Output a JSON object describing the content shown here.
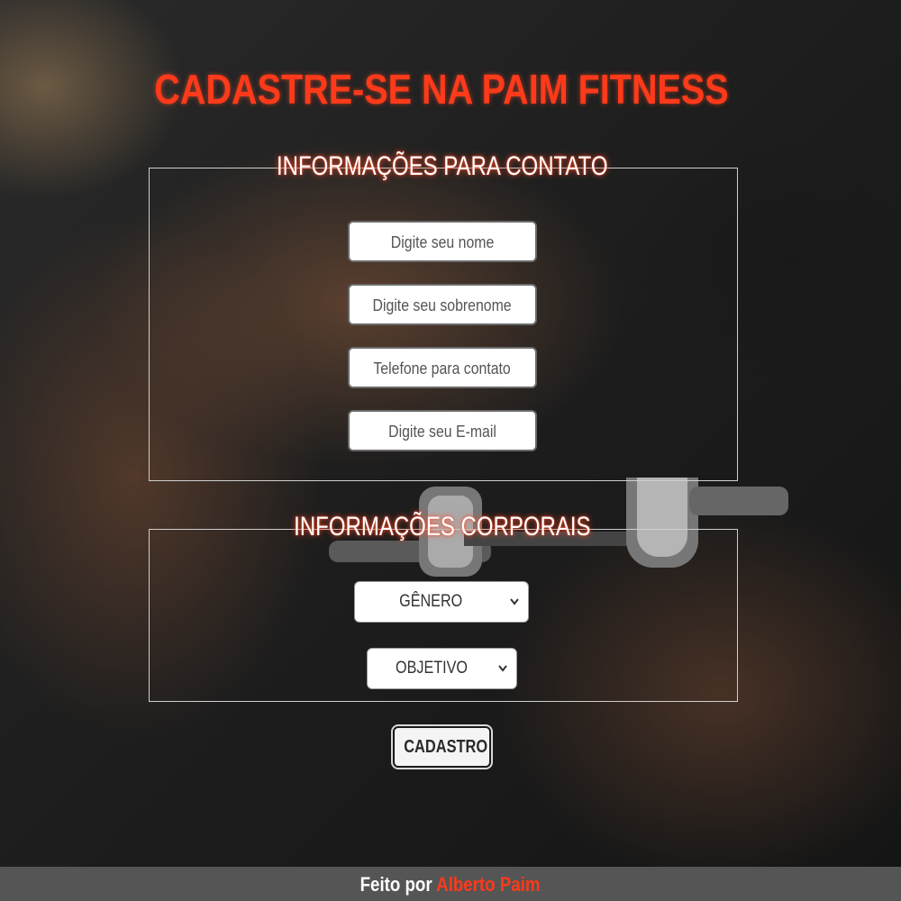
{
  "header": {
    "title": "CADASTRE-SE NA PAIM FITNESS"
  },
  "contact_section": {
    "legend": "INFORMAÇÕES PARA CONTATO",
    "fields": {
      "first_name_placeholder": "Digite seu nome",
      "last_name_placeholder": "Digite seu sobrenome",
      "phone_placeholder": "Telefone para contato",
      "email_placeholder": "Digite seu E-mail"
    }
  },
  "body_section": {
    "legend": "INFORMAÇÕES CORPORAIS",
    "gender_select": "GÊNERO",
    "goal_select": "OBJETIVO"
  },
  "submit": {
    "label": "CADASTRO"
  },
  "footer": {
    "made_by": "Feito por",
    "author": "Alberto Paim"
  },
  "colors": {
    "accent": "#ff3a1a",
    "footer_bg": "#555555"
  },
  "icons": {
    "select_arrow": "chevron-down-icon"
  }
}
